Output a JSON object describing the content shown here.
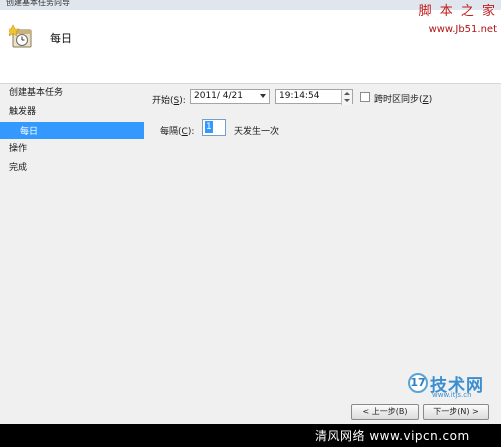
{
  "window": {
    "title": "创建基本任务向导"
  },
  "header": {
    "title": "每日"
  },
  "watermark_top": {
    "line1": "脚 本 之 家",
    "line2": "www.Jb51.net"
  },
  "nav": {
    "items": [
      {
        "label": "创建基本任务"
      },
      {
        "label": "触发器"
      },
      {
        "label": "每日",
        "selected": true
      },
      {
        "label": "操作"
      },
      {
        "label": "完成"
      }
    ]
  },
  "form": {
    "start_label": "开始(",
    "start_key": "S",
    "start_label_end": "):",
    "date_value": "2011/  4/21",
    "time_value": "19:14:54",
    "sync_label": "跨时区同步(",
    "sync_key": "Z",
    "sync_label_end": ")",
    "sync_checked": false,
    "recur_label": "每隔(",
    "recur_key": "C",
    "recur_label_end": "):",
    "recur_value": "1",
    "recur_suffix": "天发生一次"
  },
  "buttons": {
    "back": "< 上一步(B)",
    "next": "下一步(N) >"
  },
  "watermark_logo": {
    "badge": "17",
    "text": "技术网",
    "sub": "www.itjs.cn"
  },
  "banner": {
    "text": "清风网络 www.vipcn.com"
  },
  "colors": {
    "selection": "#3399ff",
    "banner": "#000000",
    "watermark_red": "#c41a1a",
    "watermark_blue": "#3b8fd0"
  }
}
